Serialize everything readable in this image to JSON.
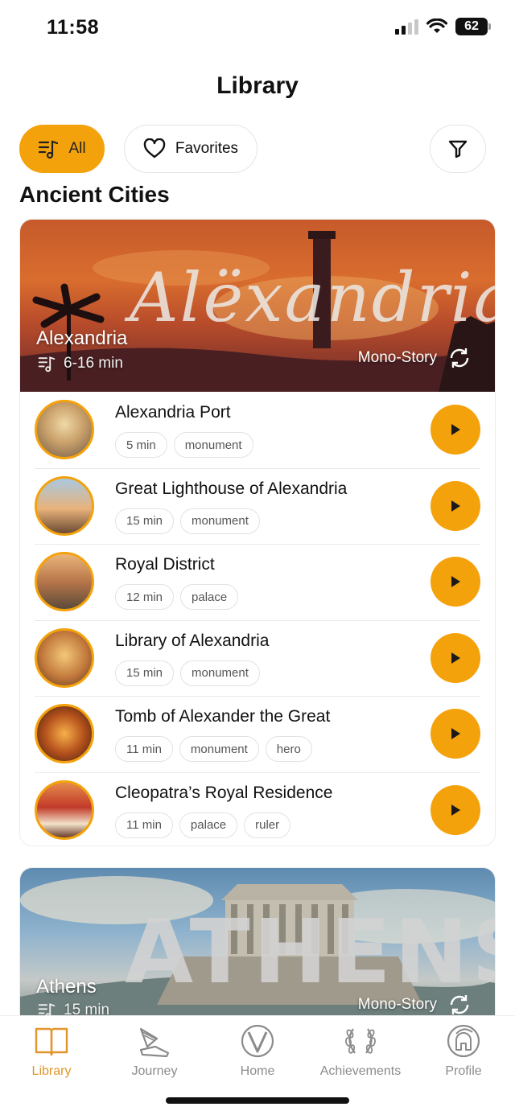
{
  "status_bar": {
    "time": "11:58",
    "battery": "62"
  },
  "header": {
    "title": "Library"
  },
  "filters": [
    {
      "label": "All",
      "icon": "music-list-icon",
      "active": true
    },
    {
      "label": "Favorites",
      "icon": "heart-icon",
      "active": false
    }
  ],
  "filter_button": {
    "icon": "funnel-icon"
  },
  "section": {
    "title": "Ancient Cities"
  },
  "cities": [
    {
      "name": "Alexandria",
      "banner_text": "Alëxandria",
      "duration": "6-16 min",
      "type": "Mono-Story",
      "stories": [
        {
          "title": "Alexandria Port",
          "tags": [
            "5 min",
            "monument"
          ]
        },
        {
          "title": "Great Lighthouse of Alexandria",
          "tags": [
            "15 min",
            "monument"
          ]
        },
        {
          "title": "Royal District",
          "tags": [
            "12 min",
            "palace"
          ]
        },
        {
          "title": "Library of Alexandria",
          "tags": [
            "15 min",
            "monument"
          ]
        },
        {
          "title": "Tomb of Alexander the Great",
          "tags": [
            "11 min",
            "monument",
            "hero"
          ]
        },
        {
          "title": "Cleopatra’s Royal Residence",
          "tags": [
            "11 min",
            "palace",
            "ruler"
          ]
        }
      ]
    },
    {
      "name": "Athens",
      "banner_text": "ATHENS",
      "duration": "15 min",
      "type": "Mono-Story"
    }
  ],
  "tabs": [
    {
      "label": "Library",
      "icon": "book-icon",
      "active": true
    },
    {
      "label": "Journey",
      "icon": "winged-sandal-icon",
      "active": false
    },
    {
      "label": "Home",
      "icon": "v-logo-icon",
      "active": false
    },
    {
      "label": "Achievements",
      "icon": "laurel-wreath-icon",
      "active": false
    },
    {
      "label": "Profile",
      "icon": "spartan-helmet-icon",
      "active": false
    }
  ],
  "colors": {
    "accent": "#f4a20c",
    "tab_active": "#e0962a",
    "tab_inactive": "#8b8b8b"
  }
}
